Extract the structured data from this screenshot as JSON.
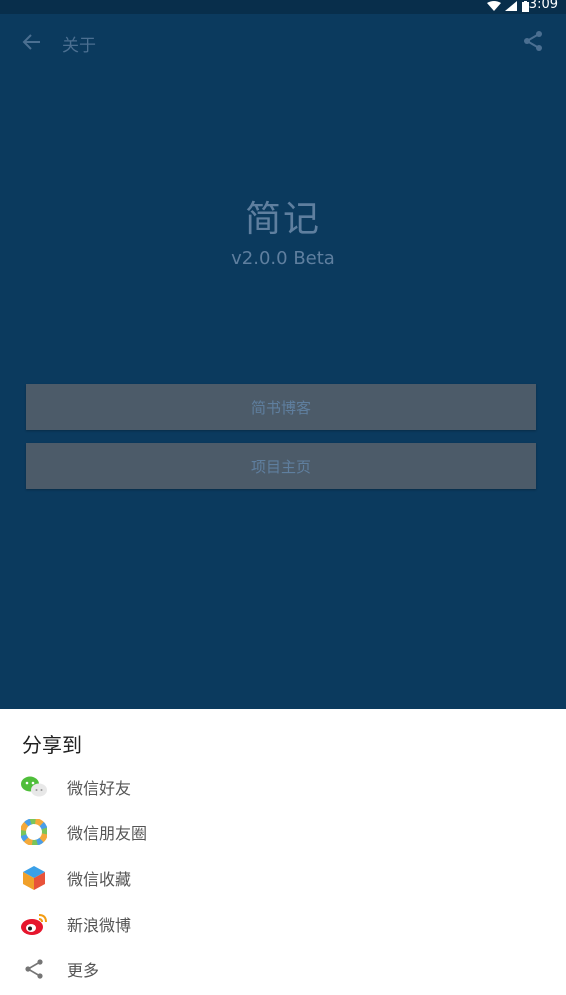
{
  "status_bar": {
    "time": "3:09"
  },
  "app_bar": {
    "title": "关于"
  },
  "about": {
    "app_name": "简记",
    "version": "v2.0.0 Beta",
    "buttons": [
      "简书博客",
      "项目主页"
    ]
  },
  "share_sheet": {
    "title": "分享到",
    "items": [
      {
        "label": "微信好友",
        "icon": "wechat-friends-icon"
      },
      {
        "label": "微信朋友圈",
        "icon": "wechat-moments-icon"
      },
      {
        "label": "微信收藏",
        "icon": "wechat-favorites-icon"
      },
      {
        "label": "新浪微博",
        "icon": "weibo-icon"
      },
      {
        "label": "更多",
        "icon": "share-icon"
      }
    ]
  },
  "colors": {
    "app_background": "#0b3a5e",
    "dim_text": "#5f7f9f",
    "button_fill": "#4c5b69",
    "sheet_background": "#ffffff"
  }
}
